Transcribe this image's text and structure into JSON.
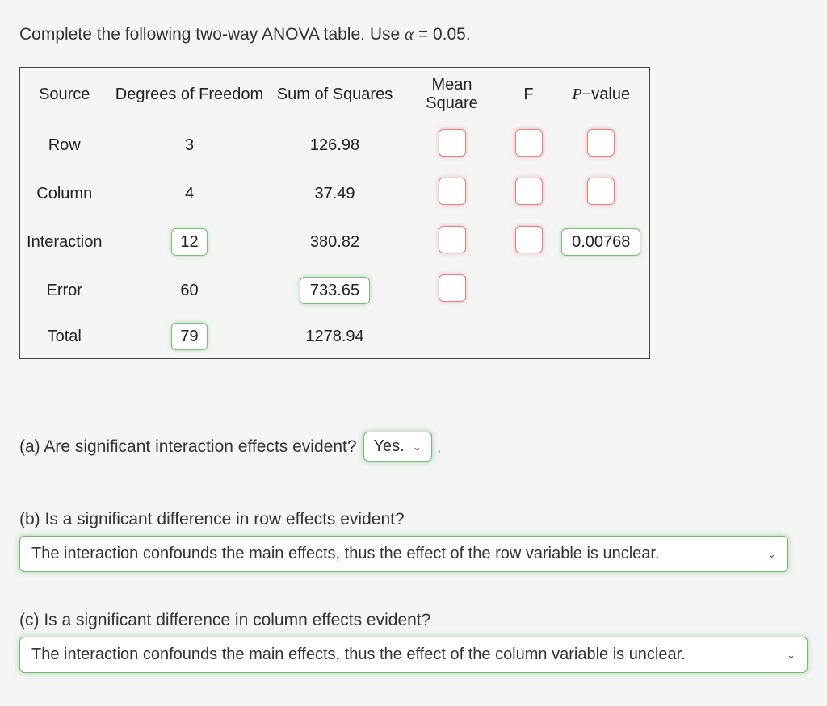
{
  "instruction": {
    "text_pre": "Complete the following two-way ANOVA table. Use ",
    "alpha_var": "α",
    "equals": " = ",
    "alpha_val": "0.05",
    "period": "."
  },
  "table": {
    "headers": {
      "source": "Source",
      "df": "Degrees of Freedom",
      "ss": "Sum of Squares",
      "ms": "Mean Square",
      "f": "F",
      "p_prefix": "P",
      "p_suffix": "−value"
    },
    "rows": {
      "row": {
        "label": "Row",
        "df": "3",
        "ss": "126.98",
        "ms": "",
        "f": "",
        "p": ""
      },
      "column": {
        "label": "Column",
        "df": "4",
        "ss": "37.49",
        "ms": "",
        "f": "",
        "p": ""
      },
      "interaction": {
        "label": "Interaction",
        "df": "12",
        "ss": "380.82",
        "ms": "",
        "f": "",
        "p": "0.00768"
      },
      "error": {
        "label": "Error",
        "df": "60",
        "ss": "733.65",
        "ms": ""
      },
      "total": {
        "label": "Total",
        "df": "79",
        "ss": "1278.94"
      }
    }
  },
  "questions": {
    "a": {
      "prompt": "(a) Are significant interaction effects evident?",
      "answer": "Yes."
    },
    "b": {
      "prompt": "(b) Is a significant difference in row effects evident?",
      "answer": "The interaction confounds the main effects, thus the effect of the row variable is unclear."
    },
    "c": {
      "prompt": "(c) Is a significant difference in column effects evident?",
      "answer": "The interaction confounds the main effects, thus the effect of the column variable is unclear."
    }
  }
}
